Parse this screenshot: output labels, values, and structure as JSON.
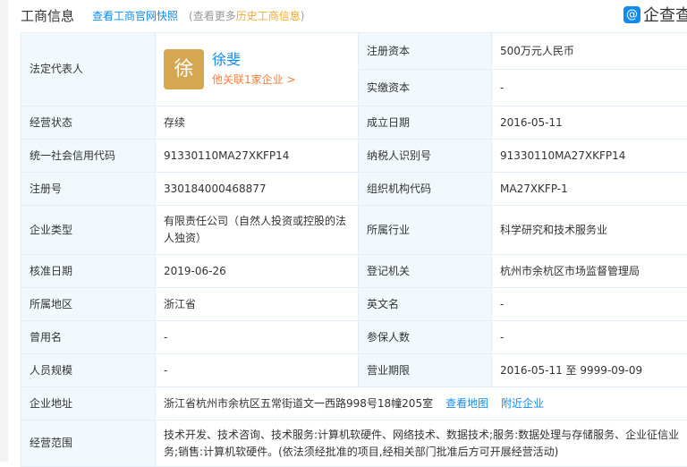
{
  "header": {
    "title": "工商信息",
    "snapshot_link": "查看工商官网快照",
    "note_prefix": "(查看更多",
    "history_link": "历史工商信息",
    "note_suffix": ")",
    "logo_text": "企查查"
  },
  "legal_rep": {
    "label": "法定代表人",
    "avatar_char": "徐",
    "name": "徐斐",
    "related": "他关联1家企业 >"
  },
  "registered_capital": {
    "label": "注册资本",
    "value": "500万元人民币"
  },
  "paid_capital": {
    "label": "实缴资本",
    "value": "-"
  },
  "rows": [
    {
      "l1": "经营状态",
      "v1": "存续",
      "l2": "成立日期",
      "v2": "2016-05-11"
    },
    {
      "l1": "统一社会信用代码",
      "v1": "91330110MA27XKFP14",
      "l2": "纳税人识别号",
      "v2": "91330110MA27XKFP14"
    },
    {
      "l1": "注册号",
      "v1": "330184000468877",
      "l2": "组织机构代码",
      "v2": "MA27XKFP-1"
    },
    {
      "l1": "企业类型",
      "v1": "有限责任公司（自然人投资或控股的法人独资）",
      "l2": "所属行业",
      "v2": "科学研究和技术服务业"
    },
    {
      "l1": "核准日期",
      "v1": "2019-06-26",
      "l2": "登记机关",
      "v2": "杭州市余杭区市场监督管理局"
    },
    {
      "l1": "所属地区",
      "v1": "浙江省",
      "l2": "英文名",
      "v2": "-"
    },
    {
      "l1": "曾用名",
      "v1": "-",
      "l2": "参保人数",
      "v2": "-"
    },
    {
      "l1": "人员规模",
      "v1": "-",
      "l2": "营业期限",
      "v2": "2016-05-11 至 9999-09-09"
    }
  ],
  "address": {
    "label": "企业地址",
    "value": "浙江省杭州市余杭区五常街道文一西路998号18幢205室",
    "map_link": "查看地图",
    "nearby_link": "附近企业"
  },
  "scope": {
    "label": "经营范围",
    "value": "技术开发、技术咨询、技术服务:计算机软硬件、网络技术、数据技术;服务:数据处理与存储服务、企业征信业务;销售:计算机软硬件。(依法须经批准的项目,经相关部门批准后方可开展经营活动)"
  }
}
